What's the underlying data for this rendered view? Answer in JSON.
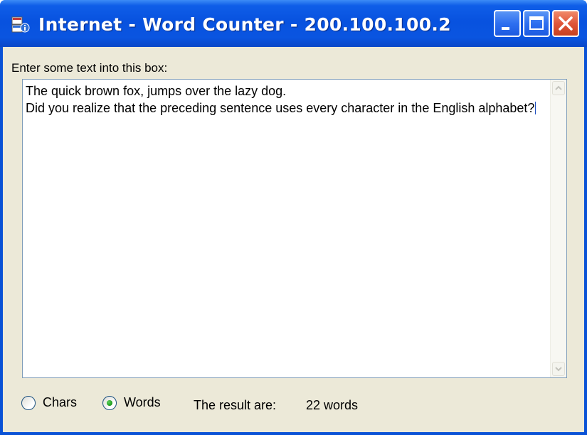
{
  "window": {
    "title": "Internet - Word Counter - 200.100.100.2",
    "icon": "app-window-icon",
    "controls": [
      "minimize-icon",
      "maximize-icon",
      "close-icon"
    ]
  },
  "form": {
    "prompt_label": "Enter some text into this box:",
    "text_lines": [
      "The quick brown fox, jumps over the lazy dog.",
      "Did you realize that the preceding sentence uses every character in the English alphabet?"
    ],
    "mode_options": [
      {
        "label": "Chars",
        "selected": false
      },
      {
        "label": "Words",
        "selected": true
      }
    ],
    "result_label": "The result are:",
    "result_value": "22 words"
  },
  "colors": {
    "titlebar": "#0a52d6",
    "client_background": "#ece9d8",
    "textbox_border": "#7f9db9",
    "radio_selected": "#21a121"
  }
}
